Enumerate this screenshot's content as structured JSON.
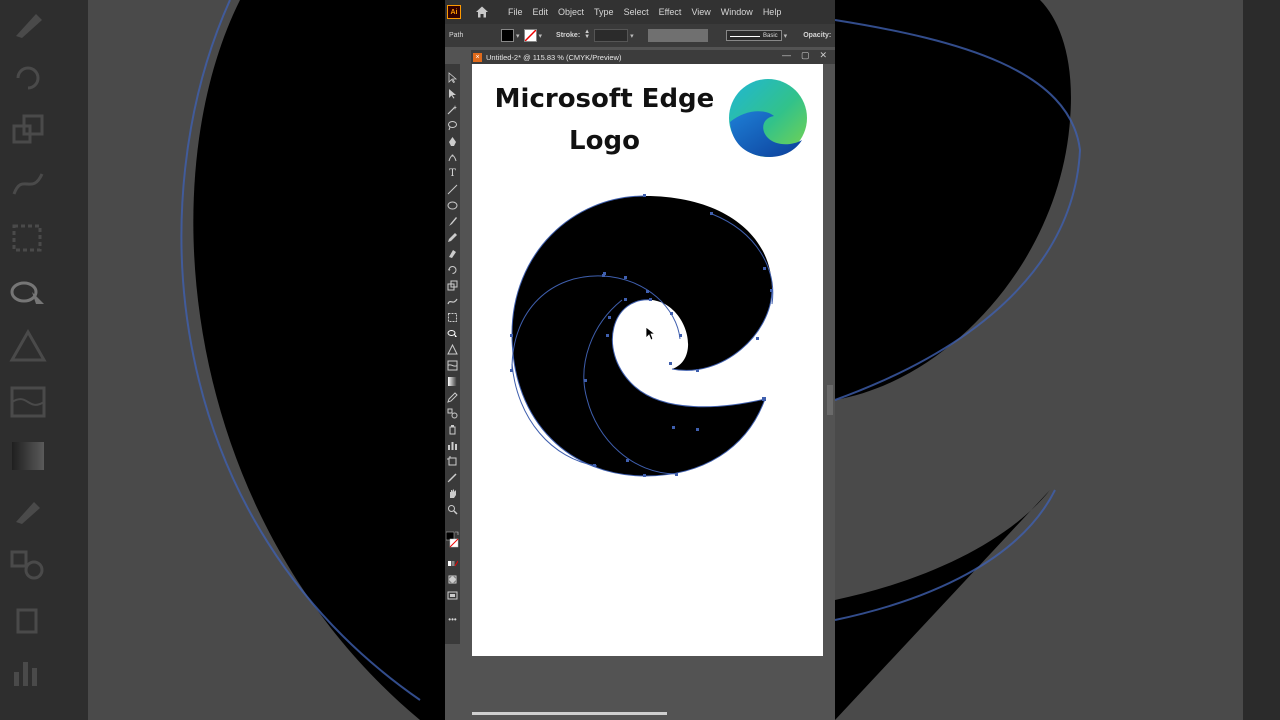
{
  "app": {
    "badge": "Ai",
    "menu": [
      "File",
      "Edit",
      "Object",
      "Type",
      "Select",
      "Effect",
      "View",
      "Window",
      "Help"
    ]
  },
  "controlbar": {
    "selection_label": "Path",
    "stroke_label": "Stroke:",
    "brush_label": "Basic",
    "opacity_label": "Opacity:"
  },
  "document": {
    "tab_title": "Untitled-2* @ 115.83 % (CMYK/Preview)",
    "close_glyph": "×",
    "minimize_glyph": "—",
    "maximize_glyph": "▢",
    "window_close_glyph": "✕"
  },
  "artboard": {
    "title_line1": "Microsoft Edge",
    "title_line2": "Logo"
  },
  "colors": {
    "accent_orange": "#e06a1b",
    "path_outline": "#3f5fae",
    "artboard_bg": "#ffffff",
    "app_bg": "#535353"
  },
  "icons": [
    "home-icon",
    "selection-tool-icon",
    "direct-selection-tool-icon",
    "magic-wand-icon",
    "lasso-icon",
    "pen-icon",
    "type-icon",
    "line-icon",
    "ellipse-icon",
    "brush-icon",
    "pencil-icon",
    "rotate-icon",
    "scale-icon",
    "warp-icon",
    "free-transform-icon",
    "shape-builder-icon",
    "perspective-icon",
    "mesh-icon",
    "gradient-icon",
    "eyedropper-icon",
    "blend-icon",
    "symbol-sprayer-icon",
    "graph-icon",
    "artboard-icon",
    "slice-icon",
    "hand-icon",
    "zoom-icon"
  ]
}
